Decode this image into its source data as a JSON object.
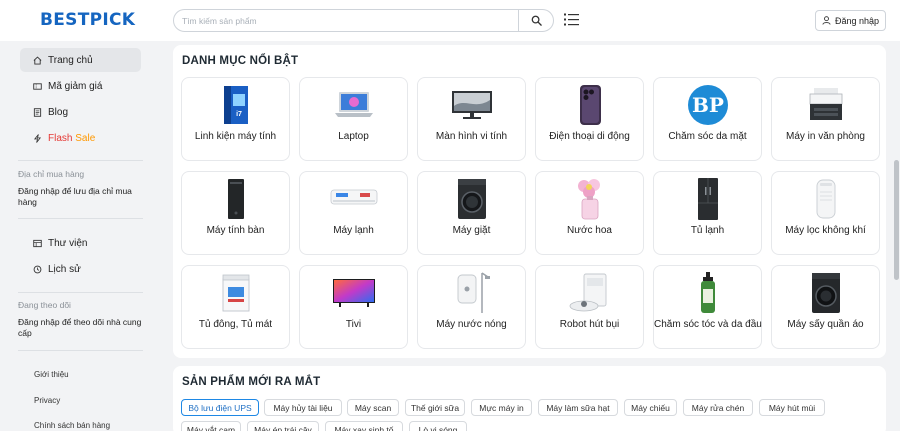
{
  "header": {
    "logo": "BESTPICK",
    "search_placeholder": "Tìm kiếm sản phẩm",
    "login_label": "Đăng nhập"
  },
  "sidebar": {
    "nav": [
      {
        "label": "Trang chủ",
        "icon": "home-icon"
      },
      {
        "label": "Mã giảm giá",
        "icon": "ticket-icon"
      },
      {
        "label": "Blog",
        "icon": "blog-icon"
      }
    ],
    "flash": {
      "part1": "Flash",
      "part2": "Sale",
      "icon": "lightning-icon"
    },
    "address_title": "Địa chỉ mua hàng",
    "address_link": "Đăng nhập để lưu địa chỉ mua hàng",
    "nav2": [
      {
        "label": "Thư viện",
        "icon": "library-icon"
      },
      {
        "label": "Lịch sử",
        "icon": "history-icon"
      }
    ],
    "following_title": "Đang theo dõi",
    "following_link": "Đăng nhập để theo dõi nhà cung cấp",
    "footer_links": [
      "Giới thiệu",
      "Privacy",
      "Chính sách bán hàng"
    ]
  },
  "categories": {
    "title": "DANH MỤC NỔI BẬT",
    "items": [
      {
        "label": "Linh kiện máy tính",
        "icon": "cpu-box-icon"
      },
      {
        "label": "Laptop",
        "icon": "laptop-icon"
      },
      {
        "label": "Màn hình vi tính",
        "icon": "monitor-icon"
      },
      {
        "label": "Điện thoại di động",
        "icon": "phone-icon"
      },
      {
        "label": "Chăm sóc da mặt",
        "icon": "bp-logo-icon"
      },
      {
        "label": "Máy in văn phòng",
        "icon": "printer-icon"
      },
      {
        "label": "Máy tính bàn",
        "icon": "desktop-tower-icon"
      },
      {
        "label": "Máy lạnh",
        "icon": "air-conditioner-icon"
      },
      {
        "label": "Máy giặt",
        "icon": "washing-machine-icon"
      },
      {
        "label": "Nước hoa",
        "icon": "perfume-icon"
      },
      {
        "label": "Tủ lạnh",
        "icon": "fridge-icon"
      },
      {
        "label": "Máy lọc không khí",
        "icon": "air-purifier-icon"
      },
      {
        "label": "Tủ đông, Tủ mát",
        "icon": "freezer-icon"
      },
      {
        "label": "Tivi",
        "icon": "tv-icon"
      },
      {
        "label": "Máy nước nóng",
        "icon": "water-heater-icon"
      },
      {
        "label": "Robot hút bụi",
        "icon": "robot-vacuum-icon"
      },
      {
        "label": "Chăm sóc tóc và da đầu",
        "icon": "shampoo-bottle-icon"
      },
      {
        "label": "Máy sấy quần áo",
        "icon": "dryer-icon"
      }
    ]
  },
  "new_products": {
    "title": "SẢN PHẨM MỚI RA MẮT",
    "row1": [
      "Bộ lưu điện UPS",
      "Máy hủy tài liệu",
      "Máy scan",
      "Thế giới sữa",
      "Mực máy in",
      "Máy làm sữa hạt",
      "Máy chiếu",
      "Máy rửa chén",
      "Máy hút mùi"
    ],
    "row2": [
      "Máy vắt cam",
      "Máy ép trái cây",
      "Máy xay sinh tố",
      "Lò vi sóng"
    ]
  },
  "colors": {
    "brand": "#1565c0",
    "accent": "#1e88e5",
    "flash_red": "#e53935",
    "flash_orange": "#ff9800"
  }
}
